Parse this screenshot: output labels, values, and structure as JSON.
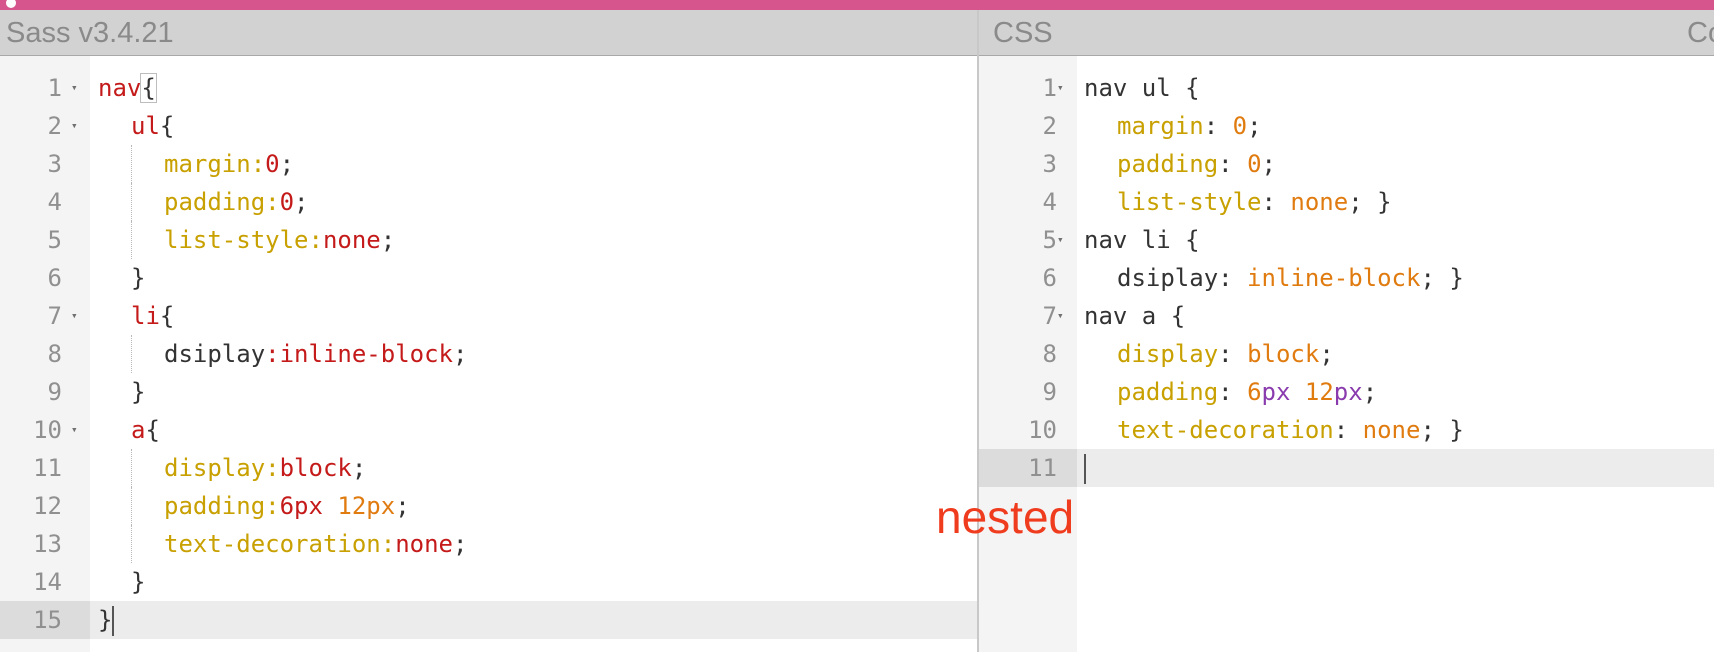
{
  "window": {
    "accent_color": "#d6558c"
  },
  "left_pane": {
    "title": "Sass v3.4.21",
    "lines": [
      {
        "n": "1",
        "fold": true,
        "indent": 0,
        "tokens": [
          {
            "t": "nav",
            "c": "sel"
          },
          {
            "t": "{",
            "c": "plain",
            "box": true
          }
        ]
      },
      {
        "n": "2",
        "fold": true,
        "indent": 1,
        "tokens": [
          {
            "t": "ul",
            "c": "sel"
          },
          {
            "t": "{",
            "c": "plain"
          }
        ]
      },
      {
        "n": "3",
        "fold": false,
        "indent": 2,
        "tokens": [
          {
            "t": "margin:",
            "c": "prop"
          },
          {
            "t": "0",
            "c": "val"
          },
          {
            "t": ";",
            "c": "plain"
          }
        ]
      },
      {
        "n": "4",
        "fold": false,
        "indent": 2,
        "tokens": [
          {
            "t": "padding:",
            "c": "prop"
          },
          {
            "t": "0",
            "c": "val"
          },
          {
            "t": ";",
            "c": "plain"
          }
        ]
      },
      {
        "n": "5",
        "fold": false,
        "indent": 2,
        "tokens": [
          {
            "t": "list-style:",
            "c": "prop"
          },
          {
            "t": "none",
            "c": "val"
          },
          {
            "t": ";",
            "c": "plain"
          }
        ]
      },
      {
        "n": "6",
        "fold": false,
        "indent": 1,
        "tokens": [
          {
            "t": "}",
            "c": "plain"
          }
        ]
      },
      {
        "n": "7",
        "fold": true,
        "indent": 1,
        "tokens": [
          {
            "t": "li",
            "c": "sel"
          },
          {
            "t": "{",
            "c": "plain"
          }
        ]
      },
      {
        "n": "8",
        "fold": false,
        "indent": 2,
        "tokens": [
          {
            "t": "dsiplay",
            "c": "plain"
          },
          {
            "t": ":inline-block",
            "c": "val"
          },
          {
            "t": ";",
            "c": "plain"
          }
        ]
      },
      {
        "n": "9",
        "fold": false,
        "indent": 1,
        "tokens": [
          {
            "t": "}",
            "c": "plain"
          }
        ]
      },
      {
        "n": "10",
        "fold": true,
        "indent": 1,
        "tokens": [
          {
            "t": "a",
            "c": "sel"
          },
          {
            "t": "{",
            "c": "plain"
          }
        ]
      },
      {
        "n": "11",
        "fold": false,
        "indent": 2,
        "tokens": [
          {
            "t": "display:",
            "c": "prop"
          },
          {
            "t": "block",
            "c": "val"
          },
          {
            "t": ";",
            "c": "plain"
          }
        ]
      },
      {
        "n": "12",
        "fold": false,
        "indent": 2,
        "tokens": [
          {
            "t": "padding:",
            "c": "prop"
          },
          {
            "t": "6px",
            "c": "val"
          },
          {
            "t": " ",
            "c": "plain"
          },
          {
            "t": "12px",
            "c": "num"
          },
          {
            "t": ";",
            "c": "plain"
          }
        ]
      },
      {
        "n": "13",
        "fold": false,
        "indent": 2,
        "tokens": [
          {
            "t": "text-decoration:",
            "c": "prop"
          },
          {
            "t": "none",
            "c": "val"
          },
          {
            "t": ";",
            "c": "plain"
          }
        ]
      },
      {
        "n": "14",
        "fold": false,
        "indent": 1,
        "tokens": [
          {
            "t": "}",
            "c": "plain"
          }
        ]
      },
      {
        "n": "15",
        "fold": false,
        "indent": 0,
        "active": true,
        "cursor": true,
        "tokens": [
          {
            "t": "}",
            "c": "plain"
          }
        ]
      }
    ]
  },
  "right_pane": {
    "title": "CSS",
    "extra_title": "Co",
    "lines": [
      {
        "n": "1",
        "fold": true,
        "indent": 0,
        "tokens": [
          {
            "t": "nav ul {",
            "c": "plain"
          }
        ]
      },
      {
        "n": "2",
        "fold": false,
        "indent": 1,
        "tokens": [
          {
            "t": "margin",
            "c": "prop"
          },
          {
            "t": ": ",
            "c": "plain"
          },
          {
            "t": "0",
            "c": "num"
          },
          {
            "t": ";",
            "c": "plain"
          }
        ]
      },
      {
        "n": "3",
        "fold": false,
        "indent": 1,
        "tokens": [
          {
            "t": "padding",
            "c": "prop"
          },
          {
            "t": ": ",
            "c": "plain"
          },
          {
            "t": "0",
            "c": "num"
          },
          {
            "t": ";",
            "c": "plain"
          }
        ]
      },
      {
        "n": "4",
        "fold": false,
        "indent": 1,
        "tokens": [
          {
            "t": "list-style",
            "c": "prop"
          },
          {
            "t": ": ",
            "c": "plain"
          },
          {
            "t": "none",
            "c": "valr"
          },
          {
            "t": "; }",
            "c": "plain"
          }
        ]
      },
      {
        "n": "5",
        "fold": true,
        "indent": 0,
        "tokens": [
          {
            "t": "nav li {",
            "c": "plain"
          }
        ]
      },
      {
        "n": "6",
        "fold": false,
        "indent": 1,
        "tokens": [
          {
            "t": "dsiplay: ",
            "c": "plain"
          },
          {
            "t": "inline-block",
            "c": "valr"
          },
          {
            "t": "; }",
            "c": "plain"
          }
        ]
      },
      {
        "n": "7",
        "fold": true,
        "indent": 0,
        "tokens": [
          {
            "t": "nav a {",
            "c": "plain"
          }
        ]
      },
      {
        "n": "8",
        "fold": false,
        "indent": 1,
        "tokens": [
          {
            "t": "display",
            "c": "prop"
          },
          {
            "t": ": ",
            "c": "plain"
          },
          {
            "t": "block",
            "c": "valr"
          },
          {
            "t": ";",
            "c": "plain"
          }
        ]
      },
      {
        "n": "9",
        "fold": false,
        "indent": 1,
        "tokens": [
          {
            "t": "padding",
            "c": "prop"
          },
          {
            "t": ": ",
            "c": "plain"
          },
          {
            "t": "6",
            "c": "num"
          },
          {
            "t": "px",
            "c": "unit"
          },
          {
            "t": " ",
            "c": "plain"
          },
          {
            "t": "12",
            "c": "num"
          },
          {
            "t": "px",
            "c": "unit"
          },
          {
            "t": ";",
            "c": "plain"
          }
        ]
      },
      {
        "n": "10",
        "fold": false,
        "indent": 1,
        "tokens": [
          {
            "t": "text-decoration",
            "c": "prop"
          },
          {
            "t": ": ",
            "c": "plain"
          },
          {
            "t": "none",
            "c": "valr"
          },
          {
            "t": "; }",
            "c": "plain"
          }
        ]
      },
      {
        "n": "11",
        "fold": false,
        "indent": 0,
        "active": true,
        "cursor": true,
        "tokens": []
      }
    ]
  },
  "annotation": {
    "text": "nested"
  }
}
